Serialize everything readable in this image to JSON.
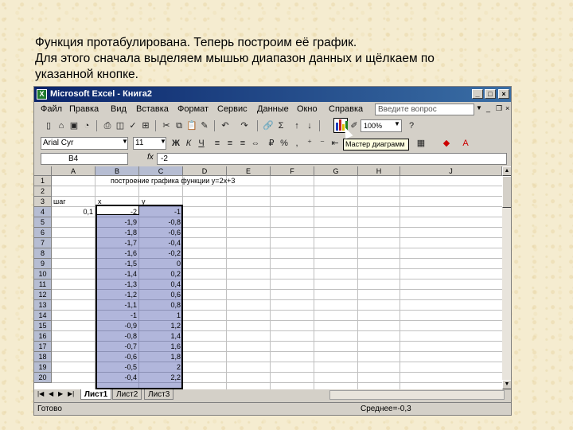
{
  "slide": {
    "line1": "Функция протабулирована. Теперь построим её график.",
    "line2": " Для этого сначала выделяем мышью диапазон данных и щёлкаем по",
    "line3": "указанной кнопке."
  },
  "window": {
    "title": "Microsoft Excel - Книга2",
    "icon": "excel-icon",
    "min_label": "_",
    "max_label": "□",
    "close_label": "×"
  },
  "menu": {
    "items": [
      "Файл",
      "Правка",
      "Вид",
      "Вставка",
      "Формат",
      "Сервис",
      "Данные",
      "Окно",
      "Справка"
    ],
    "ask_placeholder": "Введите вопрос"
  },
  "toolbar": {
    "zoom": "100%",
    "font_name": "Arial Cyr",
    "font_size": "11",
    "chart_wizard_tooltip": "Мастер диаграмм"
  },
  "formula_bar": {
    "name_box": "B4",
    "fx": "fx",
    "formula": "-2"
  },
  "grid": {
    "columns": [
      "A",
      "B",
      "C",
      "D",
      "E",
      "F",
      "G",
      "H",
      "J"
    ],
    "rows": [
      "1",
      "2",
      "3",
      "4",
      "5",
      "6",
      "7",
      "8",
      "9",
      "10",
      "11",
      "12",
      "13",
      "14",
      "15",
      "16",
      "17",
      "18",
      "19",
      "20"
    ],
    "title_cell": "построение графика функции y=2x+3",
    "step_label": "шаг",
    "step_value": "0,1",
    "x_header": "x",
    "y_header": "y",
    "x_values": [
      "-2",
      "-1,9",
      "-1,8",
      "-1,7",
      "-1,6",
      "-1,5",
      "-1,4",
      "-1,3",
      "-1,2",
      "-1,1",
      "-1",
      "-0,9",
      "-0,8",
      "-0,7",
      "-0,6",
      "-0,5",
      "-0,4"
    ],
    "y_values": [
      "-1",
      "-0,8",
      "-0,6",
      "-0,4",
      "-0,2",
      "0",
      "0,2",
      "0,4",
      "0,6",
      "0,8",
      "1",
      "1,2",
      "1,4",
      "1,6",
      "1,8",
      "2",
      "2,2"
    ]
  },
  "sheets": {
    "tabs": [
      "Лист1",
      "Лист2",
      "Лист3"
    ],
    "active": "Лист1"
  },
  "status": {
    "ready": "Готово",
    "sum": "Среднее=-0,3"
  },
  "colors": {
    "title_bar": "#0a246a",
    "selection": "#4650aa",
    "slide_bg": "#f5ecd0"
  }
}
